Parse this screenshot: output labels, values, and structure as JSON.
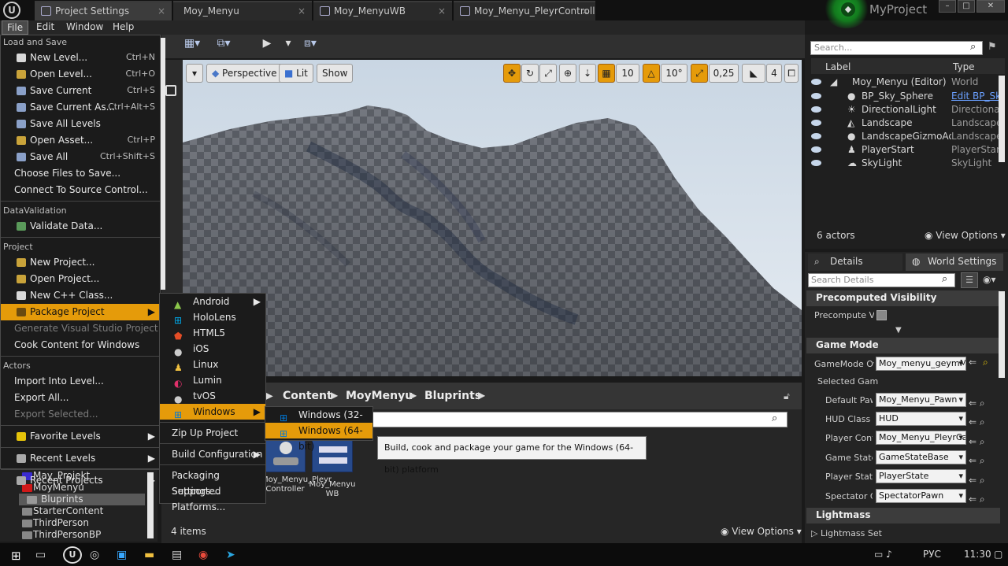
{
  "tabs": [
    {
      "label": "Project Settings"
    },
    {
      "label": "Moy_Menyu"
    },
    {
      "label": "Moy_MenyuWB"
    },
    {
      "label": "Moy_Menyu_PleyrControll"
    }
  ],
  "project_name": "MyProject",
  "menubar": [
    "File",
    "Edit",
    "Window",
    "Help"
  ],
  "file_menu": {
    "section_load_save": "Load and Save",
    "items_load_save": [
      {
        "label": "New Level...",
        "shortcut": "Ctrl+N"
      },
      {
        "label": "Open Level...",
        "shortcut": "Ctrl+O"
      },
      {
        "label": "Save Current",
        "shortcut": "Ctrl+S"
      },
      {
        "label": "Save Current As...",
        "shortcut": "Ctrl+Alt+S"
      },
      {
        "label": "Save All Levels",
        "shortcut": ""
      },
      {
        "label": "Open Asset...",
        "shortcut": "Ctrl+P"
      },
      {
        "label": "Save All",
        "shortcut": "Ctrl+Shift+S"
      },
      {
        "label": "Choose Files to Save...",
        "shortcut": ""
      },
      {
        "label": "Connect To Source Control...",
        "shortcut": ""
      }
    ],
    "section_data_validation": "DataValidation",
    "validate_data": "Validate Data...",
    "section_project": "Project",
    "new_project": "New Project...",
    "open_project": "Open Project...",
    "new_cpp_class": "New C++ Class...",
    "package_project": "Package Project",
    "generate_vs_project": "Generate Visual Studio Project",
    "cook_content": "Cook Content for Windows",
    "section_actors": "Actors",
    "import_into_level": "Import Into Level...",
    "export_all": "Export All...",
    "export_selected": "Export Selected...",
    "favorite_levels": "Favorite Levels",
    "recent_levels": "Recent Levels",
    "recent_projects": "Recent Projects"
  },
  "package_submenu": {
    "platforms": [
      "Android",
      "HoloLens",
      "HTML5",
      "iOS",
      "Linux",
      "Lumin",
      "tvOS",
      "Windows"
    ],
    "zip_project": "Zip Up Project",
    "build_configuration": "Build Configuration",
    "packaging_settings": "Packaging Settings...",
    "supported_platforms": "Supported Platforms..."
  },
  "windows_submenu": [
    "Windows (32-bit)",
    "Windows (64-bit)"
  ],
  "tooltip": "Build, cook and package your game for the Windows (64-bit) platform",
  "viewport": {
    "perspective": "Perspective",
    "lit": "Lit",
    "show": "Show",
    "grid_snap": "10",
    "rot_snap": "10°",
    "scale_snap": "0,25",
    "cam_speed": "4"
  },
  "content_browser": {
    "breadcrumb": [
      "Content",
      "MoyMenyu",
      "Bluprints"
    ],
    "assets": [
      "Moy_Menyu_Pleyr Controller",
      "Moy_Menyu WB"
    ],
    "item_count": "4 items",
    "view_options": "View Options"
  },
  "folder_tree": [
    "May_Projekt",
    "MoyMenyu",
    "Bluprints",
    "StarterContent",
    "ThirdPerson",
    "ThirdPersonBP"
  ],
  "outliner": {
    "search_placeholder": "Search...",
    "col_label": "Label",
    "col_type": "Type",
    "rows": [
      {
        "label": "Moy_Menyu (Editor)",
        "type": "World"
      },
      {
        "label": "BP_Sky_Sphere",
        "type": "Edit BP_Sky"
      },
      {
        "label": "DirectionalLight",
        "type": "DirectionalLi"
      },
      {
        "label": "Landscape",
        "type": "Landscape"
      },
      {
        "label": "LandscapeGizmoActiv",
        "type": "LandscapeGi"
      },
      {
        "label": "PlayerStart",
        "type": "PlayerStart"
      },
      {
        "label": "SkyLight",
        "type": "SkyLight"
      }
    ],
    "actor_count": "6 actors",
    "view_options": "View Options"
  },
  "details": {
    "tab_details": "Details",
    "tab_world_settings": "World Settings",
    "search_placeholder": "Search Details",
    "sec_precomputed": "Precomputed Visibility",
    "precomputed_label": "Precompute Vi",
    "sec_game_mode": "Game Mode",
    "gamemode_label": "GameMode Ov",
    "gamemode_value": "Moy_menyu_geymM",
    "selected_gam": "Selected Gam",
    "props": [
      {
        "label": "Default Paw",
        "value": "Moy_Menyu_Pawn"
      },
      {
        "label": "HUD Class",
        "value": "HUD"
      },
      {
        "label": "Player Contr",
        "value": "Moy_Menyu_PleyrCa"
      },
      {
        "label": "Game State",
        "value": "GameStateBase"
      },
      {
        "label": "Player State",
        "value": "PlayerState"
      },
      {
        "label": "Spectator Cl",
        "value": "SpectatorPawn"
      }
    ],
    "sec_lightmass": "Lightmass",
    "lightmass_set": "Lightmass Set"
  },
  "taskbar": {
    "lang": "РУС",
    "time": "11:30"
  }
}
